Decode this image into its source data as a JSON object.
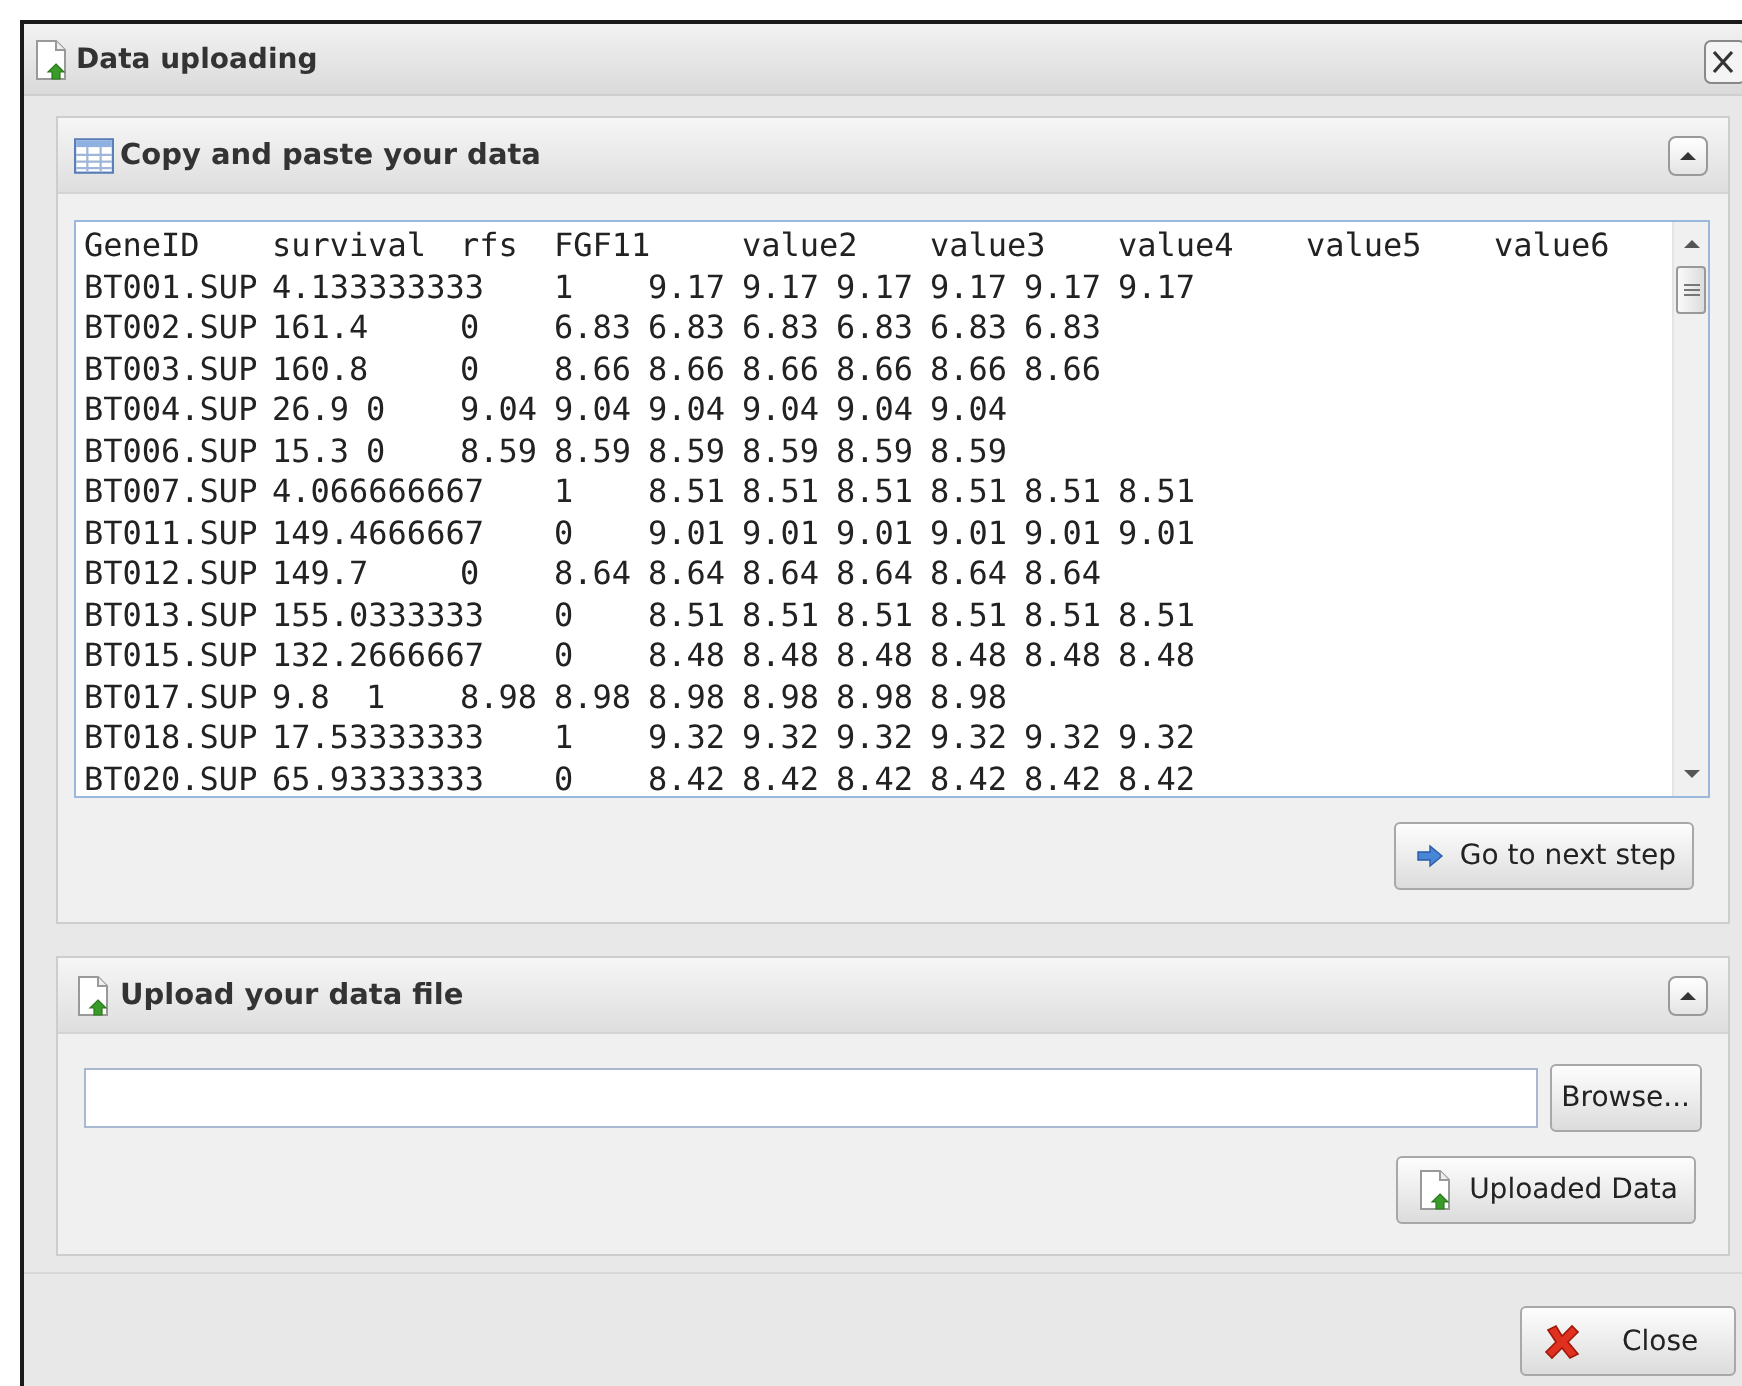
{
  "window": {
    "title": "Data uploading"
  },
  "paste_panel": {
    "title": "Copy and paste your data",
    "expanded": true,
    "lines": [
      "GeneID\tsurvival\trfs\tFGF11\tvalue2\tvalue3\tvalue4\tvalue5\tvalue6",
      "BT001.SUP\t4.133333333\t1\t9.17\t9.17\t9.17\t9.17\t9.17\t9.17",
      "BT002.SUP\t161.4\t0\t6.83\t6.83\t6.83\t6.83\t6.83\t6.83",
      "BT003.SUP\t160.8\t0\t8.66\t8.66\t8.66\t8.66\t8.66\t8.66",
      "BT004.SUP\t26.9\t0\t9.04\t9.04\t9.04\t9.04\t9.04\t9.04",
      "BT006.SUP\t15.3\t0\t8.59\t8.59\t8.59\t8.59\t8.59\t8.59",
      "BT007.SUP\t4.066666667\t1\t8.51\t8.51\t8.51\t8.51\t8.51\t8.51",
      "BT011.SUP\t149.4666667\t0\t9.01\t9.01\t9.01\t9.01\t9.01\t9.01",
      "BT012.SUP\t149.7\t0\t8.64\t8.64\t8.64\t8.64\t8.64\t8.64",
      "BT013.SUP\t155.0333333\t0\t8.51\t8.51\t8.51\t8.51\t8.51\t8.51",
      "BT015.SUP\t132.2666667\t0\t8.48\t8.48\t8.48\t8.48\t8.48\t8.48",
      "BT017.SUP\t9.8\t1\t8.98\t8.98\t8.98\t8.98\t8.98\t8.98",
      "BT018.SUP\t17.53333333\t1\t9.32\t9.32\t9.32\t9.32\t9.32\t9.32",
      "BT020.SUP\t65.93333333\t0\t8.42\t8.42\t8.42\t8.42\t8.42\t8.42"
    ],
    "next_button": "Go to next step"
  },
  "upload_panel": {
    "title": "Upload your data file",
    "expanded": true,
    "browse_button": "Browse...",
    "upload_button": "Uploaded Data"
  },
  "footer": {
    "close_button": "Close"
  }
}
